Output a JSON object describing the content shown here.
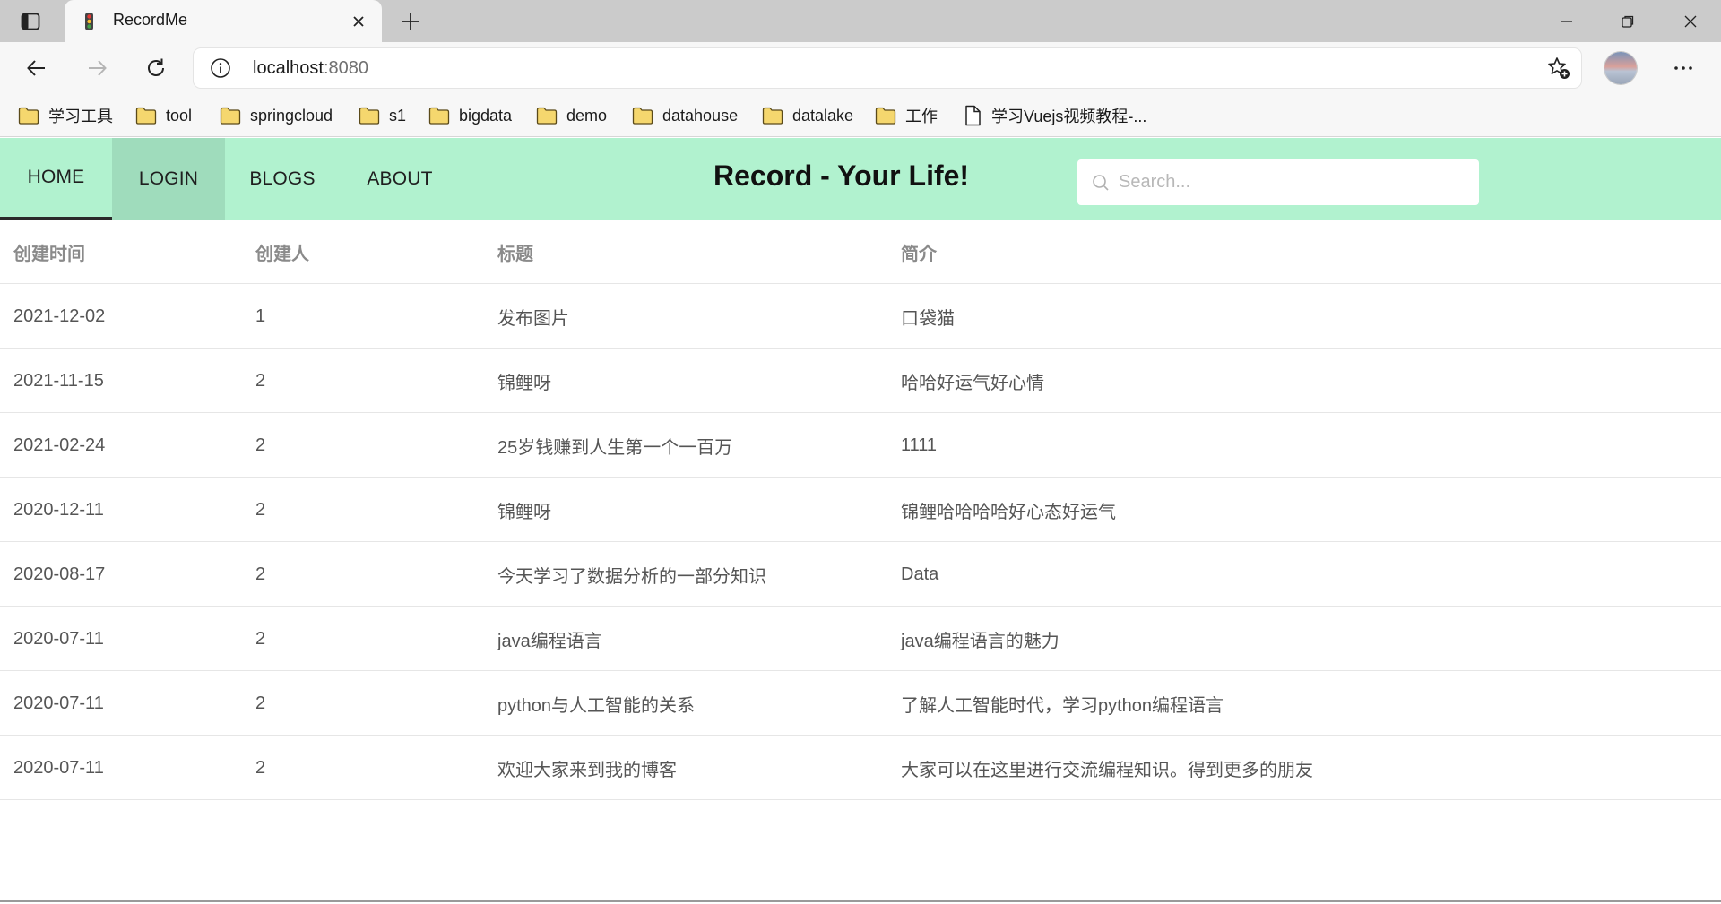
{
  "browser": {
    "tab_title": "RecordMe",
    "address_host": "localhost",
    "address_port": ":8080",
    "bookmarks": [
      {
        "label": "学习工具",
        "icon": "folder-icon"
      },
      {
        "label": "tool",
        "icon": "folder-icon"
      },
      {
        "label": "springcloud",
        "icon": "folder-icon"
      },
      {
        "label": "s1",
        "icon": "folder-icon"
      },
      {
        "label": "bigdata",
        "icon": "folder-icon"
      },
      {
        "label": "demo",
        "icon": "folder-icon"
      },
      {
        "label": "datahouse",
        "icon": "folder-icon"
      },
      {
        "label": "datalake",
        "icon": "folder-icon"
      },
      {
        "label": "工作",
        "icon": "folder-icon"
      },
      {
        "label": "学习Vuejs视频教程-...",
        "icon": "page-icon"
      }
    ]
  },
  "nav": {
    "items": [
      "HOME",
      "LOGIN",
      "BLOGS",
      "ABOUT"
    ],
    "active": "HOME",
    "hovered": "LOGIN",
    "brand": "Record - Your Life!",
    "search_placeholder": "Search..."
  },
  "table": {
    "headers": [
      "创建时间",
      "创建人",
      "标题",
      "简介"
    ],
    "rows": [
      [
        "2021-12-02",
        "1",
        "发布图片",
        "口袋猫"
      ],
      [
        "2021-11-15",
        "2",
        "锦鲤呀",
        "哈哈好运气好心情"
      ],
      [
        "2021-02-24",
        "2",
        "25岁钱赚到人生第一个一百万",
        "1111"
      ],
      [
        "2020-12-11",
        "2",
        "锦鲤呀",
        "锦鲤哈哈哈哈好心态好运气"
      ],
      [
        "2020-08-17",
        "2",
        "今天学习了数据分析的一部分知识",
        "Data"
      ],
      [
        "2020-07-11",
        "2",
        "java编程语言",
        "java编程语言的魅力"
      ],
      [
        "2020-07-11",
        "2",
        "python与人工智能的关系",
        "了解人工智能时代，学习python编程语言"
      ],
      [
        "2020-07-11",
        "2",
        "欢迎大家来到我的博客",
        "大家可以在这里进行交流编程知识。得到更多的朋友"
      ]
    ]
  },
  "colors": {
    "navbar_bg": "#b1f2cf",
    "nav_hover_bg": "#9fdcbc",
    "folder_fill": "#f5d76e"
  }
}
